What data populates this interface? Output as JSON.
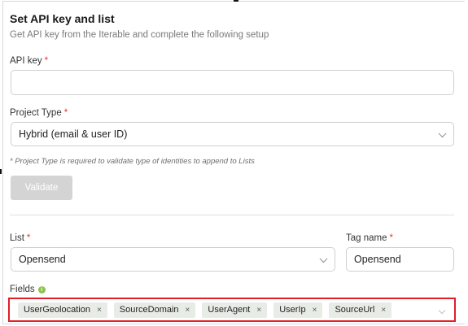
{
  "header": {
    "title": "Set API key and list",
    "subtitle": "Get API key from the Iterable and complete the following setup"
  },
  "api_key": {
    "label": "API key",
    "required": "*",
    "value": ""
  },
  "project_type": {
    "label": "Project Type",
    "required": "*",
    "selected": "Hybrid (email & user ID)"
  },
  "note": "* Project Type is required to validate type of identities to append to Lists",
  "validate_button": {
    "label": "Validate",
    "enabled": false
  },
  "list": {
    "label": "List",
    "required": "*",
    "selected": "Opensend"
  },
  "tag_name": {
    "label": "Tag name",
    "required": "*",
    "value": "Opensend"
  },
  "fields": {
    "label": "Fields",
    "info_icon": "info-icon",
    "tags": [
      {
        "label": "UserGeolocation",
        "remove": "×"
      },
      {
        "label": "SourceDomain",
        "remove": "×"
      },
      {
        "label": "UserAgent",
        "remove": "×"
      },
      {
        "label": "UserIp",
        "remove": "×"
      },
      {
        "label": "SourceUrl",
        "remove": "×"
      }
    ]
  },
  "colors": {
    "required": "#e53935",
    "highlight_border": "#e01f26",
    "tag_bg": "#e8ece6",
    "info_icon": "#8bc34a",
    "button_disabled": "#d4d4d4"
  }
}
